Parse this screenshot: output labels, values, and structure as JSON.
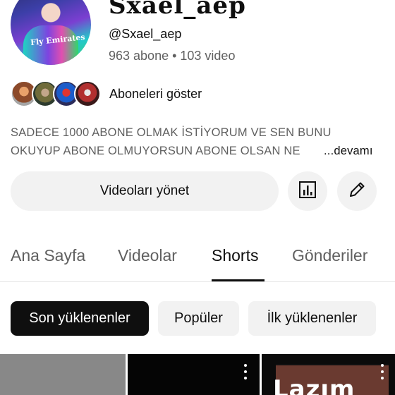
{
  "channel": {
    "name": "Sxael_aep",
    "handle": "@Sxael_aep",
    "stats": "963 abone • 103 video",
    "avatar_shirt_text": "Fly Emirates"
  },
  "subscribers": {
    "show_label": "Aboneleri göster"
  },
  "description": {
    "line1": "SADECE 1000 ABONE OLMAK İSTİYORUM VE SEN BUNU",
    "line2": "OKUYUP ABONE OLMUYORSUN ABONE OLSAN NE",
    "more": "...devamı"
  },
  "actions": {
    "manage_videos": "Videoları yönet",
    "analytics_icon": "bar-chart-icon",
    "edit_icon": "pencil-icon"
  },
  "tabs": [
    {
      "label": "Ana Sayfa",
      "active": false
    },
    {
      "label": "Videolar",
      "active": false
    },
    {
      "label": "Shorts",
      "active": true
    },
    {
      "label": "Gönderiler",
      "active": false
    }
  ],
  "filters": [
    {
      "label": "Son yüklenenler",
      "active": true
    },
    {
      "label": "Popüler",
      "active": false
    },
    {
      "label": "İlk yüklenenler",
      "active": false
    }
  ],
  "shorts": [
    {
      "overlay_text": ""
    },
    {
      "overlay_text": ""
    },
    {
      "overlay_text": "Lazım"
    }
  ],
  "colors": {
    "text_primary": "#0f0f0f",
    "text_secondary": "#606060",
    "chip_bg": "#f2f2f2",
    "chip_active_bg": "#0f0f0f"
  }
}
